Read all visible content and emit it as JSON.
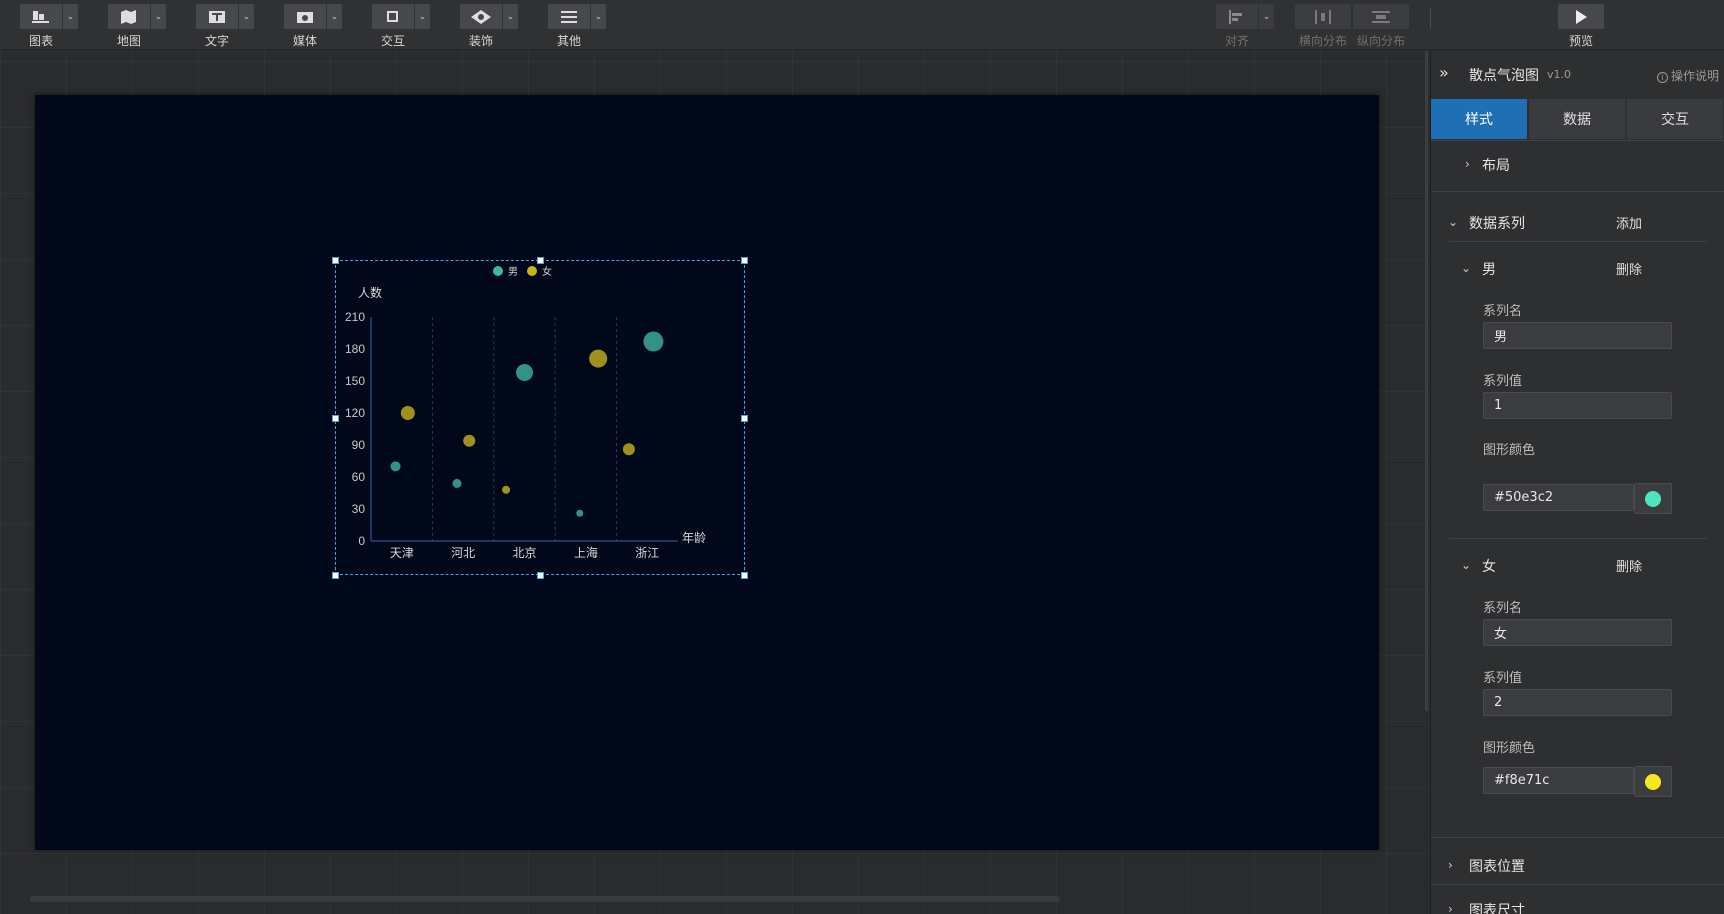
{
  "toolbar": {
    "items": [
      {
        "label": "图表",
        "icon": "chart-icon"
      },
      {
        "label": "地图",
        "icon": "map-icon"
      },
      {
        "label": "文字",
        "icon": "text-icon"
      },
      {
        "label": "媒体",
        "icon": "media-icon"
      },
      {
        "label": "交互",
        "icon": "interaction-icon"
      },
      {
        "label": "装饰",
        "icon": "decoration-icon"
      },
      {
        "label": "其他",
        "icon": "other-icon"
      }
    ],
    "align_label": "对齐",
    "hdist_label": "横向分布",
    "vdist_label": "纵向分布",
    "preview_label": "预览"
  },
  "panel": {
    "title": "散点气泡图",
    "version": "v1.0",
    "help": "操作说明",
    "tabs": [
      "样式",
      "数据",
      "交互"
    ],
    "active_tab": "样式",
    "layout_label": "布局",
    "series_section": "数据系列",
    "add_label": "添加",
    "delete_label": "删除",
    "series": [
      {
        "header": "男",
        "name_label": "系列名",
        "name": "男",
        "value_label": "系列值",
        "value": "1",
        "color_label": "图形颜色",
        "color": "#50e3c2"
      },
      {
        "header": "女",
        "name_label": "系列名",
        "name": "女",
        "value_label": "系列值",
        "value": "2",
        "color_label": "图形颜色",
        "color": "#f8e71c"
      }
    ],
    "position_label": "图表位置",
    "size_label": "图表尺寸"
  },
  "chart_data": {
    "type": "scatter",
    "legend": [
      "男",
      "女"
    ],
    "legend_placement": "top-center",
    "colors": {
      "男": "#3fb6a0",
      "女": "#c8b41c"
    },
    "ylabel": "人数",
    "xlabel": "年龄",
    "categories": [
      "天津",
      "河北",
      "北京",
      "上海",
      "浙江"
    ],
    "yticks": [
      0,
      30,
      60,
      90,
      120,
      150,
      180,
      210
    ],
    "ylim": [
      0,
      210
    ],
    "series": [
      {
        "name": "男",
        "points": [
          {
            "x": 0.4,
            "y": 70,
            "size": 10
          },
          {
            "x": 1.4,
            "y": 54,
            "size": 9
          },
          {
            "x": 2.5,
            "y": 158,
            "size": 17
          },
          {
            "x": 3.4,
            "y": 26,
            "size": 7
          },
          {
            "x": 4.6,
            "y": 187,
            "size": 20
          }
        ]
      },
      {
        "name": "女",
        "points": [
          {
            "x": 0.6,
            "y": 120,
            "size": 14
          },
          {
            "x": 1.6,
            "y": 94,
            "size": 12
          },
          {
            "x": 2.2,
            "y": 48,
            "size": 8
          },
          {
            "x": 3.7,
            "y": 171,
            "size": 18
          },
          {
            "x": 4.2,
            "y": 86,
            "size": 12
          }
        ]
      }
    ],
    "grid": "vertical-dashed"
  }
}
